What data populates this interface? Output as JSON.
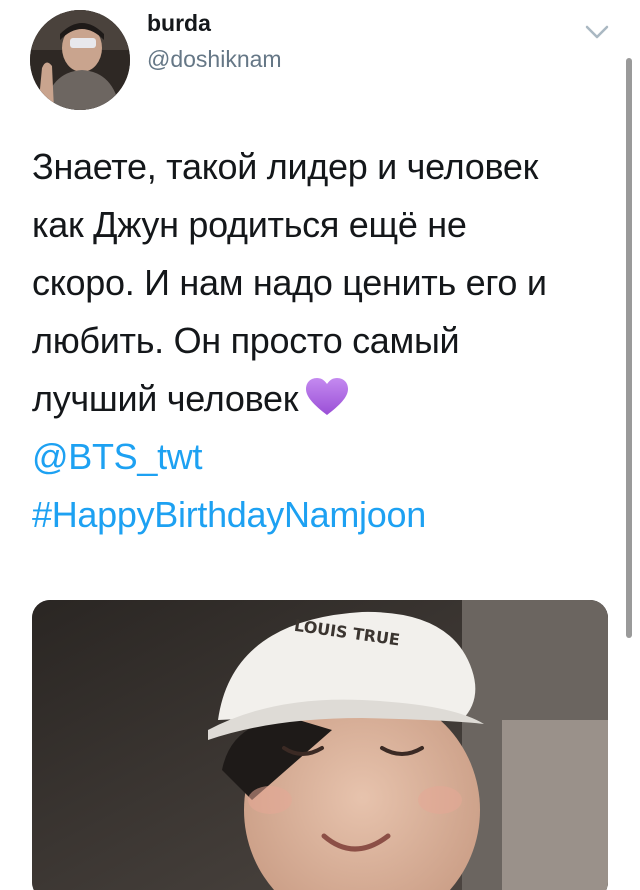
{
  "tweet": {
    "author": {
      "display_name": "burda",
      "handle": "@doshiknam"
    },
    "text_lines": [
      "Знаете, такой лидер и человек",
      "как Джун родиться ещё не",
      "скоро. И нам надо ценить его и",
      "любить. Он просто самый",
      "лучший человек"
    ],
    "emoji": "purple-heart",
    "mention": "@BTS_twt",
    "hashtag": "#HappyBirthdayNamjoon",
    "media": {
      "cap_text": "LOUIS TRUE"
    }
  },
  "colors": {
    "link": "#1da1f2",
    "text": "#14171a",
    "secondary": "#657786",
    "heart": "#a45bd8"
  }
}
